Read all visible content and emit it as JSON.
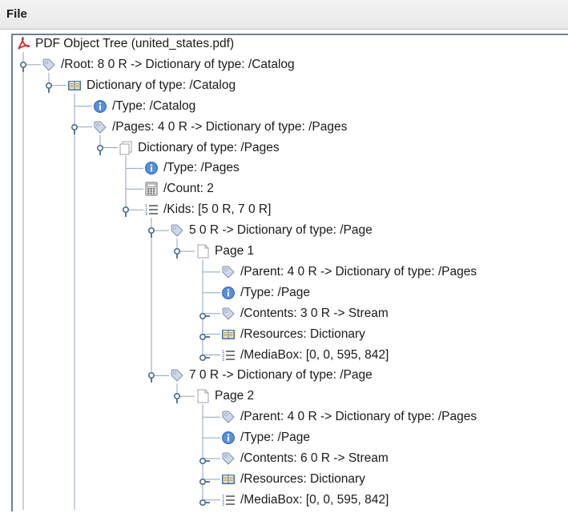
{
  "menu": {
    "file": "File"
  },
  "tree": [
    {
      "level": 0,
      "icon": "pdf-icon",
      "handle": "none",
      "label": "PDF Object Tree (united_states.pdf)"
    },
    {
      "level": 1,
      "icon": "tag-icon",
      "handle": "expanded",
      "label": "/Root: 8 0 R -> Dictionary of type: /Catalog"
    },
    {
      "level": 2,
      "icon": "book-icon",
      "handle": "expanded",
      "label": "Dictionary of type: /Catalog"
    },
    {
      "level": 3,
      "icon": "info-icon",
      "handle": "leaf",
      "label": "/Type: /Catalog"
    },
    {
      "level": 3,
      "icon": "tag-icon",
      "handle": "expanded",
      "label": "/Pages: 4 0 R -> Dictionary of type: /Pages"
    },
    {
      "level": 4,
      "icon": "pages-icon",
      "handle": "expanded",
      "label": "Dictionary of type: /Pages"
    },
    {
      "level": 5,
      "icon": "info-icon",
      "handle": "leaf",
      "label": "/Type: /Pages"
    },
    {
      "level": 5,
      "icon": "calculator-icon",
      "handle": "leaf",
      "label": "/Count: 2"
    },
    {
      "level": 5,
      "icon": "list-icon",
      "handle": "expanded",
      "label": "/Kids: [5 0 R, 7 0 R]"
    },
    {
      "level": 6,
      "icon": "tag-icon",
      "handle": "expanded",
      "label": "5 0 R -> Dictionary of type: /Page"
    },
    {
      "level": 7,
      "icon": "page-icon",
      "handle": "expanded",
      "label": "Page 1"
    },
    {
      "level": 8,
      "icon": "tag-icon",
      "handle": "leaf",
      "label": "/Parent: 4 0 R -> Dictionary of type: /Pages"
    },
    {
      "level": 8,
      "icon": "info-icon",
      "handle": "leaf",
      "label": "/Type: /Page"
    },
    {
      "level": 8,
      "icon": "tag-icon",
      "handle": "collapsed",
      "label": "/Contents: 3 0 R -> Stream"
    },
    {
      "level": 8,
      "icon": "book-icon",
      "handle": "collapsed",
      "label": "/Resources: Dictionary"
    },
    {
      "level": 8,
      "icon": "list-icon",
      "handle": "collapsed",
      "label": "/MediaBox: [0, 0, 595, 842]"
    },
    {
      "level": 6,
      "icon": "tag-icon",
      "handle": "expanded",
      "label": "7 0 R -> Dictionary of type: /Page"
    },
    {
      "level": 7,
      "icon": "page-icon",
      "handle": "expanded",
      "label": "Page 2"
    },
    {
      "level": 8,
      "icon": "tag-icon",
      "handle": "leaf",
      "label": "/Parent: 4 0 R -> Dictionary of type: /Pages"
    },
    {
      "level": 8,
      "icon": "info-icon",
      "handle": "leaf",
      "label": "/Type: /Page"
    },
    {
      "level": 8,
      "icon": "tag-icon",
      "handle": "collapsed",
      "label": "/Contents: 6 0 R -> Stream"
    },
    {
      "level": 8,
      "icon": "book-icon",
      "handle": "collapsed",
      "label": "/Resources: Dictionary"
    },
    {
      "level": 8,
      "icon": "list-icon",
      "handle": "collapsed",
      "label": "/MediaBox: [0, 0, 595, 842]"
    }
  ],
  "colors": {
    "tree_line": "#8fa3bd",
    "handle": "#4a6a93",
    "pdf_red": "#d32a2a",
    "tag_fill": "#cfd8e8",
    "tag_stroke": "#7f93b0",
    "book_fill": "#3b6db5",
    "info_fill": "#2f6cc0"
  }
}
